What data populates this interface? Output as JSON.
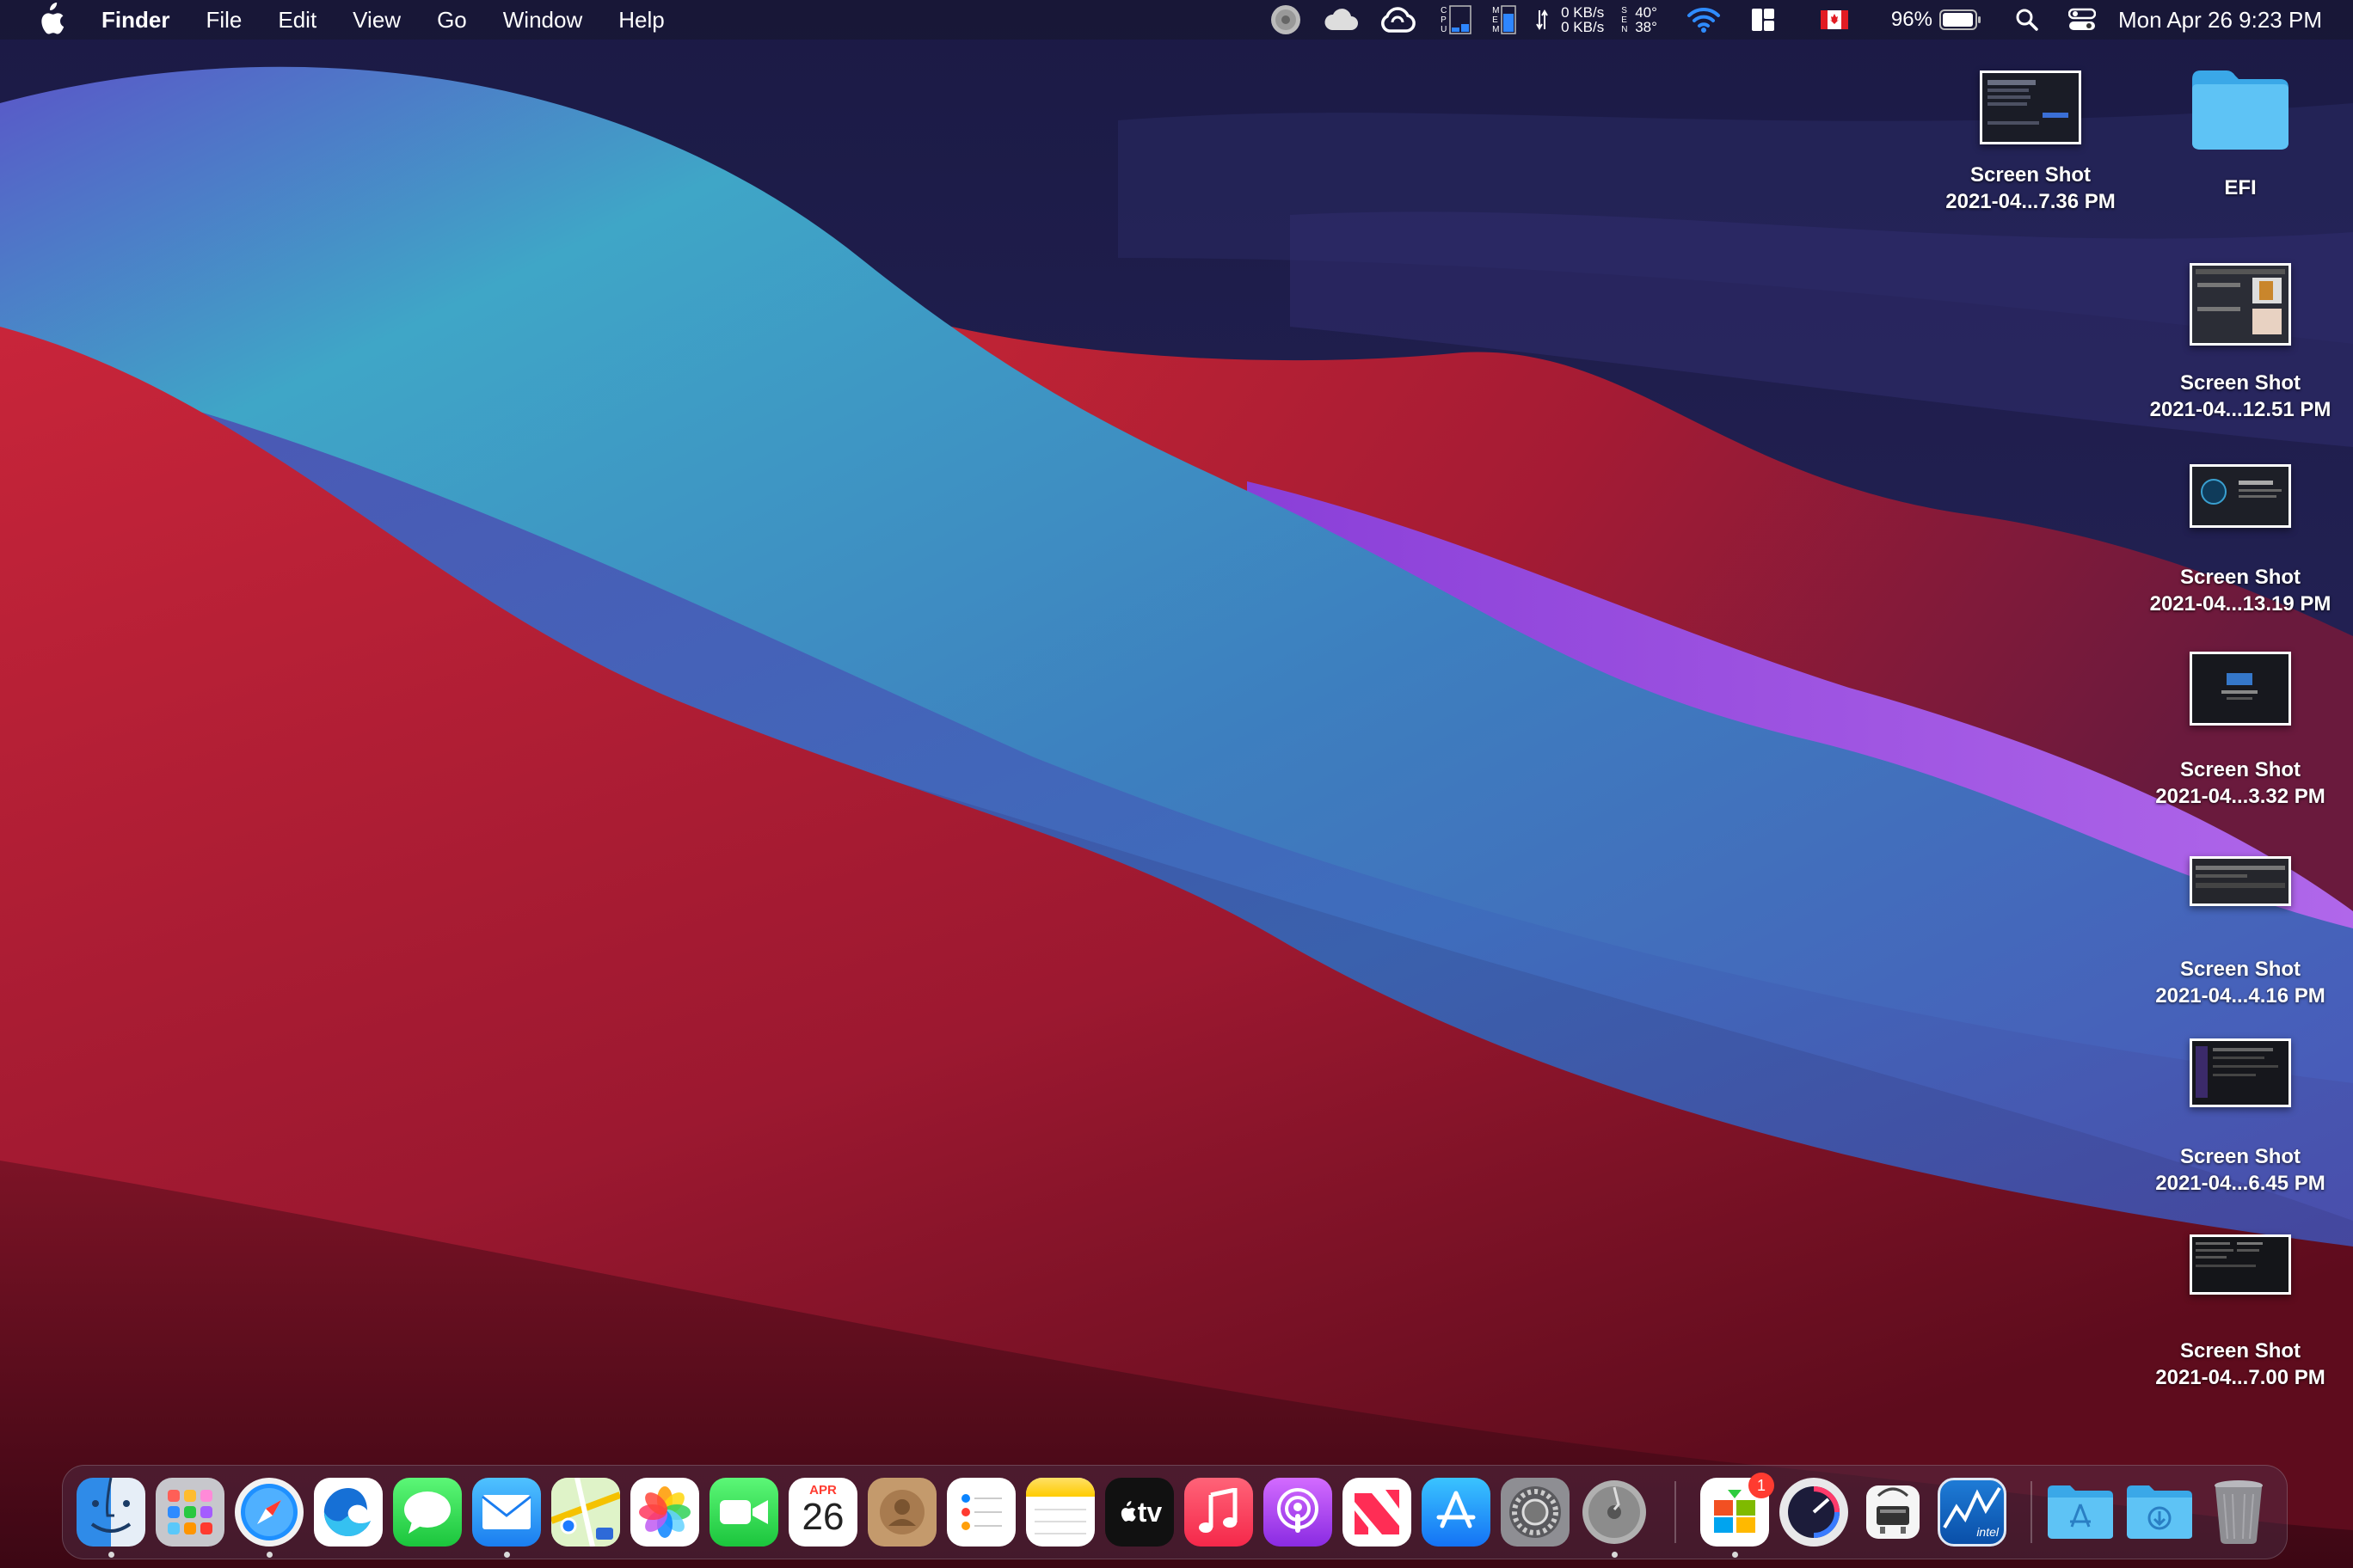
{
  "menubar": {
    "app_name": "Finder",
    "menus": [
      "File",
      "Edit",
      "View",
      "Go",
      "Window",
      "Help"
    ],
    "status": {
      "net_up": "0 KB/s",
      "net_down": "0 KB/s",
      "temp_1": "40°",
      "temp_2": "38°",
      "battery": "96%",
      "clock": "Mon Apr 26  9:23 PM",
      "cpu_label": "CPU",
      "mem_label": "MEM",
      "sen_label": "SEN"
    }
  },
  "desktop": {
    "items": [
      {
        "name": "Screen Shot",
        "sub": "2021-04...7.36 PM"
      },
      {
        "name": "EFI",
        "sub": ""
      },
      {
        "name": "Screen Shot",
        "sub": "2021-04...12.51 PM"
      },
      {
        "name": "Screen Shot",
        "sub": "2021-04...13.19 PM"
      },
      {
        "name": "Screen Shot",
        "sub": "2021-04...3.32 PM"
      },
      {
        "name": "Screen Shot",
        "sub": "2021-04...4.16 PM"
      },
      {
        "name": "Screen Shot",
        "sub": "2021-04...6.45 PM"
      },
      {
        "name": "Screen Shot",
        "sub": "2021-04...7.00 PM"
      }
    ]
  },
  "dock": {
    "calendar_month": "APR",
    "calendar_day": "26",
    "tv_label": "tv",
    "badge_count": "1",
    "intel_label": "intel",
    "apps": [
      "Finder",
      "Launchpad",
      "Safari",
      "Microsoft Edge",
      "Messages",
      "Mail",
      "Maps",
      "Photos",
      "FaceTime",
      "Calendar",
      "Contacts",
      "Reminders",
      "Notes",
      "TV",
      "Music",
      "Podcasts",
      "News",
      "App Store",
      "System Preferences",
      "Disk Utility",
      "Microsoft Store",
      "Monitor",
      "Hackintool",
      "Intel Power Gadget",
      "Applications",
      "Downloads",
      "Trash"
    ]
  },
  "colors": {
    "menubar_bg": "#16162c",
    "wallpaper_dark": "#1a1b40",
    "wallpaper_teal": "#3aa0c4",
    "wallpaper_red": "#c42a3a",
    "wallpaper_purple": "#a14fe0"
  }
}
